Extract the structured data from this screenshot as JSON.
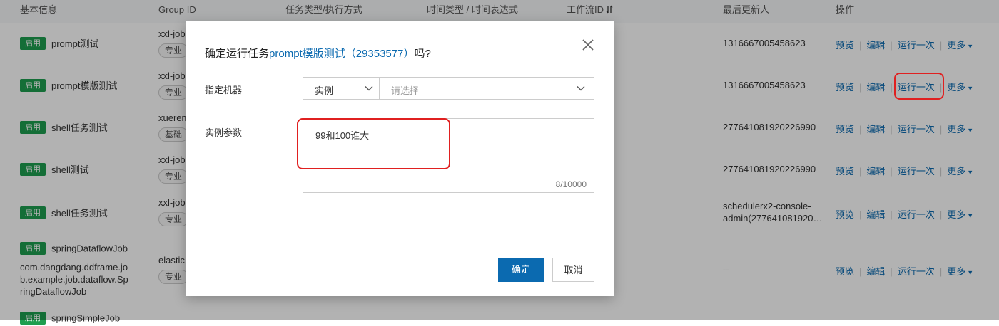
{
  "table": {
    "headers": {
      "basic": "基本信息",
      "group": "Group ID",
      "task_type": "任务类型/执行方式",
      "time_type": "时间类型 / 时间表达式",
      "workflow": "工作流ID",
      "updater": "最后更新人",
      "ops": "操作"
    },
    "status_label": "启用",
    "actions": {
      "preview": "预览",
      "edit": "编辑",
      "run_once": "运行一次",
      "more": "更多"
    },
    "rows": [
      {
        "name": "prompt测试",
        "group": "xxl-job",
        "group_tag": "专业",
        "updater": "1316667005458623"
      },
      {
        "name": "prompt模版测试",
        "group": "xxl-job",
        "group_tag": "专业",
        "updater": "1316667005458623"
      },
      {
        "name": "shell任务测试",
        "group": "xuerem",
        "group_tag": "基础",
        "updater": "277641081920226990"
      },
      {
        "name": "shell测试",
        "group": "xxl-job",
        "group_tag": "专业",
        "updater": "277641081920226990"
      },
      {
        "name": "shell任务测试",
        "group": "xxl-job",
        "group_tag": "专业",
        "updater_line1": "schedulerx2-console-",
        "updater_line2": "admin(277641081920…"
      },
      {
        "name": "springDataflowJob",
        "desc1": "com.dangdang.ddframe.jo",
        "desc2": "b.example.job.dataflow.Sp",
        "desc3": "ringDataflowJob",
        "group": "elastic",
        "group_tag": "专业",
        "updater": "--"
      },
      {
        "name": "springSimpleJob"
      }
    ]
  },
  "dialog": {
    "title_prefix": "确定运行任务",
    "title_task": "prompt模版测试（29353577）",
    "title_suffix": "吗?",
    "machine_label": "指定机器",
    "machine_type": "实例",
    "machine_placeholder": "请选择",
    "param_label": "实例参数",
    "param_value": "99和100谁大",
    "param_counter": "8/10000",
    "ok_label": "确定",
    "cancel_label": "取消"
  },
  "colors": {
    "accent": "#0b6ab0",
    "status_green": "#1e9e4f",
    "highlight_red": "#e02020"
  },
  "icons": {
    "close": "close-icon",
    "chevron": "chevron-down-icon",
    "sort": "sort-icon"
  }
}
